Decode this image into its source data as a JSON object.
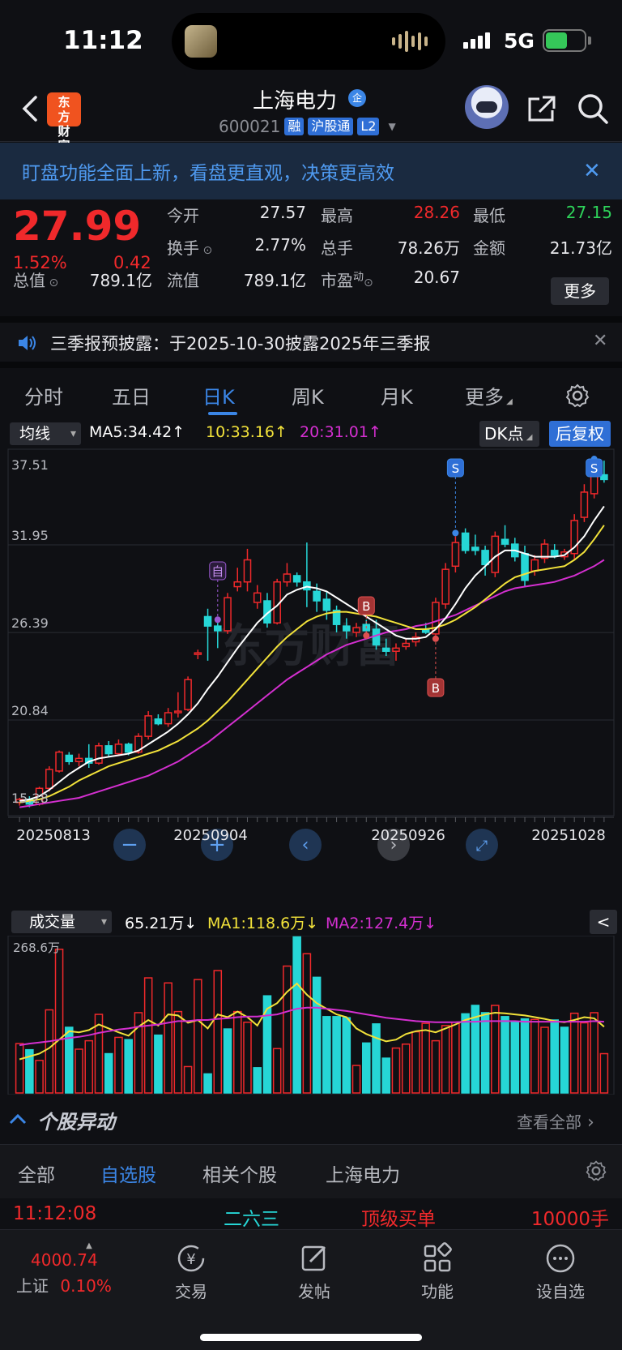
{
  "status_bar": {
    "time": "11:12",
    "network": "5G"
  },
  "header": {
    "logo_text": "东方财富",
    "stock_name": "上海电力",
    "qi_badge": "企",
    "code": "600021",
    "tags": [
      "融",
      "沪股通",
      "L2"
    ]
  },
  "banner": {
    "text": "盯盘功能全面上新，看盘更直观，决策更高效"
  },
  "quote": {
    "price": "27.99",
    "change_pct": "1.52%",
    "change": "0.42",
    "fields": {
      "open": {
        "label": "今开",
        "value": "27.57"
      },
      "high": {
        "label": "最高",
        "value": "28.26"
      },
      "low": {
        "label": "最低",
        "value": "27.15"
      },
      "turnover": {
        "label": "换手",
        "value": "2.77%"
      },
      "volume": {
        "label": "总手",
        "value": "78.26万"
      },
      "amount": {
        "label": "金额",
        "value": "21.73亿"
      },
      "mktcap": {
        "label": "总值",
        "value": "789.1亿"
      },
      "float": {
        "label": "流值",
        "value": "789.1亿"
      },
      "pe": {
        "label": "市盈",
        "label_sup": "动",
        "value": "20.67"
      }
    },
    "more_label": "更多"
  },
  "notice": {
    "text": "三季报预披露：于2025-10-30披露2025年三季报"
  },
  "tabs": [
    "分时",
    "五日",
    "日K",
    "周K",
    "月K",
    "更多"
  ],
  "active_tab": "日K",
  "ma_bar": {
    "selector": "均线",
    "ma5": "MA5:34.42↑",
    "ma10": "10:33.16↑",
    "ma20": "20:31.01↑",
    "dk": "DK点",
    "fq": "后复权"
  },
  "chart_data": [
    {
      "type": "candlestick",
      "title": "日K",
      "y_ticks": [
        "37.51",
        "31.95",
        "26.39",
        "20.84",
        "15.28"
      ],
      "ylim": [
        15.28,
        37.51
      ],
      "x_ticks": [
        "20250813",
        "20250904",
        "20250926",
        "20251028"
      ],
      "watermark": "东方财富",
      "markers": [
        {
          "label": "自",
          "kind": "self"
        },
        {
          "label": "B",
          "kind": "buy"
        },
        {
          "label": "B",
          "kind": "buy"
        },
        {
          "label": "S",
          "kind": "sell"
        },
        {
          "label": "S",
          "kind": "sell"
        }
      ],
      "candles": [
        [
          15.6,
          15.9,
          15.4,
          15.8
        ],
        [
          15.8,
          16.0,
          15.3,
          15.5
        ],
        [
          15.5,
          16.6,
          15.4,
          16.5
        ],
        [
          16.5,
          17.9,
          16.3,
          17.7
        ],
        [
          17.6,
          18.9,
          17.5,
          18.8
        ],
        [
          18.6,
          18.8,
          18.0,
          18.2
        ],
        [
          18.2,
          18.7,
          17.9,
          18.4
        ],
        [
          18.4,
          19.3,
          17.8,
          18.1
        ],
        [
          18.1,
          19.4,
          18.0,
          19.2
        ],
        [
          19.2,
          19.5,
          18.5,
          18.7
        ],
        [
          18.7,
          19.6,
          18.6,
          19.3
        ],
        [
          19.3,
          19.4,
          18.6,
          18.8
        ],
        [
          18.8,
          20.0,
          18.7,
          19.8
        ],
        [
          19.8,
          21.4,
          19.6,
          21.1
        ],
        [
          20.9,
          21.2,
          20.5,
          20.6
        ],
        [
          20.6,
          21.6,
          20.4,
          21.3
        ],
        [
          21.3,
          22.6,
          21.0,
          21.4
        ],
        [
          21.5,
          23.6,
          21.4,
          23.4
        ],
        [
          25.0,
          25.3,
          24.7,
          25.1
        ],
        [
          27.4,
          27.9,
          24.6,
          26.8
        ],
        [
          26.8,
          27.0,
          25.4,
          26.5
        ],
        [
          26.5,
          28.9,
          26.3,
          28.6
        ],
        [
          29.3,
          30.5,
          29.0,
          29.6
        ],
        [
          29.6,
          31.7,
          29.0,
          31.0
        ],
        [
          28.3,
          29.4,
          27.9,
          28.9
        ],
        [
          28.4,
          28.9,
          26.7,
          27.0
        ],
        [
          27.0,
          29.8,
          26.9,
          29.6
        ],
        [
          29.6,
          30.8,
          29.3,
          30.1
        ],
        [
          30.0,
          30.2,
          29.3,
          29.6
        ],
        [
          29.6,
          32.1,
          28.0,
          29.1
        ],
        [
          29.0,
          29.5,
          27.7,
          28.4
        ],
        [
          28.5,
          29.0,
          27.2,
          27.8
        ],
        [
          27.8,
          28.1,
          26.4,
          26.9
        ],
        [
          26.8,
          27.3,
          26.0,
          26.5
        ],
        [
          26.4,
          27.0,
          26.1,
          26.7
        ],
        [
          26.9,
          27.2,
          26.4,
          26.5
        ],
        [
          26.6,
          27.2,
          25.3,
          25.6
        ],
        [
          25.4,
          26.0,
          24.9,
          25.2
        ],
        [
          25.2,
          25.7,
          24.6,
          25.4
        ],
        [
          25.5,
          26.0,
          25.3,
          25.7
        ],
        [
          25.8,
          26.4,
          25.5,
          26.1
        ],
        [
          26.6,
          27.0,
          26.3,
          26.4
        ],
        [
          26.3,
          28.6,
          26.2,
          28.3
        ],
        [
          28.2,
          30.8,
          27.9,
          30.4
        ],
        [
          30.6,
          32.5,
          30.2,
          32.1
        ],
        [
          32.7,
          33.0,
          31.4,
          31.6
        ],
        [
          31.8,
          32.6,
          31.3,
          31.6
        ],
        [
          31.6,
          31.9,
          30.0,
          30.7
        ],
        [
          30.2,
          32.8,
          29.9,
          32.5
        ],
        [
          32.3,
          33.2,
          31.8,
          32.0
        ],
        [
          32.0,
          32.4,
          30.9,
          31.2
        ],
        [
          31.4,
          31.9,
          29.3,
          29.7
        ],
        [
          30.3,
          31.3,
          30.0,
          31.0
        ],
        [
          31.1,
          32.3,
          30.8,
          32.0
        ],
        [
          31.6,
          32.0,
          31.1,
          31.3
        ],
        [
          31.2,
          31.7,
          31.0,
          31.5
        ],
        [
          31.4,
          33.9,
          31.0,
          33.5
        ],
        [
          33.7,
          35.8,
          33.4,
          35.3
        ],
        [
          35.2,
          37.2,
          34.9,
          36.8
        ],
        [
          36.4,
          37.3,
          35.9,
          36.1
        ]
      ],
      "ma5": [
        15.7,
        15.8,
        16.0,
        16.4,
        16.9,
        17.4,
        17.8,
        18.2,
        18.4,
        18.5,
        18.6,
        18.7,
        18.9,
        19.3,
        19.7,
        20.1,
        20.6,
        21.2,
        21.9,
        22.8,
        23.6,
        24.5,
        25.4,
        26.2,
        27.0,
        27.6,
        28.1,
        28.8,
        29.1,
        29.3,
        29.2,
        29.0,
        28.6,
        28.2,
        27.8,
        27.4,
        27.0,
        26.6,
        26.2,
        26.0,
        26.0,
        26.1,
        26.6,
        27.3,
        28.2,
        29.2,
        30.0,
        30.6,
        31.2,
        31.6,
        31.6,
        31.4,
        31.2,
        31.2,
        31.2,
        31.3,
        31.8,
        32.5,
        33.5,
        34.4
      ],
      "ma10": [
        15.6,
        15.7,
        15.8,
        16.0,
        16.3,
        16.6,
        17.0,
        17.3,
        17.6,
        17.9,
        18.1,
        18.3,
        18.5,
        18.7,
        18.9,
        19.2,
        19.5,
        19.9,
        20.3,
        20.8,
        21.4,
        22.0,
        22.7,
        23.4,
        24.1,
        24.8,
        25.5,
        26.1,
        26.6,
        27.1,
        27.4,
        27.6,
        27.7,
        27.7,
        27.6,
        27.5,
        27.4,
        27.2,
        27.0,
        26.8,
        26.6,
        26.6,
        26.7,
        26.9,
        27.2,
        27.6,
        28.0,
        28.5,
        29.0,
        29.5,
        29.9,
        30.1,
        30.3,
        30.4,
        30.5,
        30.6,
        31.0,
        31.5,
        32.3,
        33.2
      ],
      "ma20": [
        15.3,
        15.4,
        15.5,
        15.6,
        15.7,
        15.8,
        15.9,
        16.1,
        16.3,
        16.5,
        16.7,
        16.9,
        17.1,
        17.3,
        17.6,
        17.9,
        18.2,
        18.6,
        19.0,
        19.4,
        19.9,
        20.4,
        20.9,
        21.4,
        21.9,
        22.4,
        22.9,
        23.4,
        23.8,
        24.2,
        24.6,
        25.0,
        25.3,
        25.6,
        25.8,
        26.0,
        26.2,
        26.4,
        26.5,
        26.6,
        26.8,
        26.9,
        27.1,
        27.3,
        27.5,
        27.8,
        28.1,
        28.4,
        28.7,
        29.0,
        29.2,
        29.3,
        29.4,
        29.5,
        29.6,
        29.8,
        30.0,
        30.3,
        30.6,
        31.0
      ]
    },
    {
      "type": "bar",
      "title": "成交量",
      "y_ticks": [
        "268.6万"
      ],
      "ylim": [
        0,
        268.6
      ],
      "legend": {
        "vol": "65.21万↓",
        "ma1": "MA1:118.6万↓",
        "ma2": "MA2:127.4万↓"
      },
      "values": [
        88,
        77,
        58,
        148,
        256,
        117,
        78,
        93,
        140,
        70,
        99,
        95,
        143,
        205,
        103,
        196,
        145,
        47,
        202,
        34,
        218,
        114,
        145,
        126,
        45,
        173,
        79,
        226,
        278,
        248,
        206,
        136,
        136,
        134,
        49,
        89,
        123,
        62,
        80,
        87,
        109,
        124,
        93,
        120,
        126,
        141,
        156,
        143,
        156,
        136,
        127,
        132,
        131,
        117,
        130,
        117,
        142,
        125,
        143,
        70
      ],
      "up": [
        1,
        0,
        1,
        1,
        1,
        0,
        1,
        1,
        1,
        0,
        1,
        0,
        1,
        1,
        0,
        1,
        1,
        1,
        1,
        0,
        1,
        0,
        1,
        1,
        0,
        0,
        1,
        1,
        0,
        1,
        0,
        0,
        0,
        0,
        1,
        0,
        0,
        0,
        1,
        1,
        1,
        1,
        1,
        1,
        1,
        0,
        0,
        0,
        1,
        0,
        0,
        0,
        1,
        1,
        0,
        0,
        1,
        1,
        1,
        1
      ],
      "ma1": [
        60,
        65,
        70,
        80,
        95,
        110,
        108,
        112,
        122,
        115,
        108,
        102,
        118,
        130,
        120,
        140,
        138,
        125,
        130,
        115,
        140,
        135,
        145,
        135,
        120,
        150,
        160,
        180,
        195,
        175,
        160,
        150,
        140,
        135,
        115,
        105,
        98,
        92,
        95,
        105,
        110,
        112,
        108,
        115,
        122,
        130,
        135,
        140,
        143,
        142,
        140,
        138,
        135,
        132,
        128,
        126,
        130,
        135,
        133,
        118
      ],
      "ma2": [
        85,
        88,
        90,
        92,
        95,
        98,
        100,
        103,
        107,
        110,
        113,
        115,
        118,
        120,
        122,
        125,
        128,
        128,
        130,
        130,
        132,
        133,
        135,
        136,
        136,
        138,
        140,
        145,
        150,
        152,
        152,
        150,
        148,
        146,
        143,
        140,
        137,
        134,
        132,
        130,
        128,
        127,
        126,
        126,
        126,
        127,
        127,
        128,
        128,
        128,
        128,
        127,
        127,
        127,
        127,
        127,
        127,
        127,
        128,
        127
      ]
    }
  ],
  "volume_bar": {
    "selector": "成交量",
    "collapse": "<"
  },
  "anomaly": {
    "title": "个股异动",
    "view_all": "查看全部",
    "tabs": [
      "全部",
      "自选股",
      "相关个股",
      "上海电力"
    ],
    "active_tab": "自选股",
    "row": {
      "time": "11:12:08",
      "stock": "二六三",
      "event": "顶级买单",
      "amount": "10000手"
    }
  },
  "bottom_nav": {
    "index_value": "4000.74",
    "index_name": "上证",
    "index_pct": "0.10%",
    "items": [
      "交易",
      "发帖",
      "功能",
      "设自选"
    ]
  }
}
